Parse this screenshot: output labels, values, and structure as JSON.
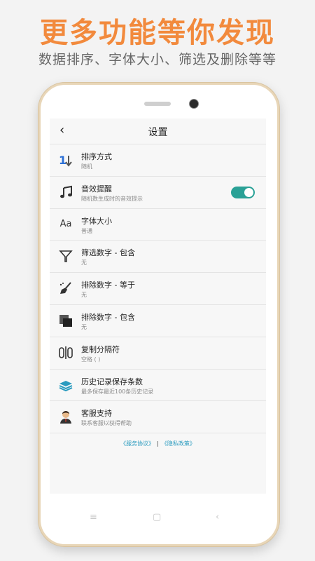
{
  "promo": {
    "headline": "更多功能等你发现",
    "subline": "数据排序、字体大小、筛选及删除等等"
  },
  "header": {
    "back_icon": "chevron-left-icon",
    "title": "设置"
  },
  "settings": [
    {
      "label": "排序方式",
      "sub": "随机",
      "icon": "sort-icon"
    },
    {
      "label": "音效提醒",
      "sub": "随机数生成时的音效提示",
      "icon": "music-note-icon",
      "toggle": true
    },
    {
      "label": "字体大小",
      "sub": "普通",
      "icon": "font-size-icon",
      "icon_text": "Aa"
    },
    {
      "label": "筛选数字 - 包含",
      "sub": "无",
      "icon": "filter-icon"
    },
    {
      "label": "排除数字 - 等于",
      "sub": "无",
      "icon": "broom-icon"
    },
    {
      "label": "排除数字 - 包含",
      "sub": "无",
      "icon": "overlap-squares-icon"
    },
    {
      "label": "复制分隔符",
      "sub": "空格 ( )",
      "icon": "separator-icon"
    },
    {
      "label": "历史记录保存条数",
      "sub": "最多保存最近100条历史记录",
      "icon": "layers-icon"
    },
    {
      "label": "客服支持",
      "sub": "联系客服以获得帮助",
      "icon": "support-avatar-icon"
    }
  ],
  "footer": {
    "service_agreement": "《服务协议》",
    "separator": "|",
    "privacy_policy": "《隐私政策》"
  },
  "colors": {
    "accent": "#f28a3d",
    "toggle": "#2aa196",
    "link": "#2a9bbf"
  }
}
